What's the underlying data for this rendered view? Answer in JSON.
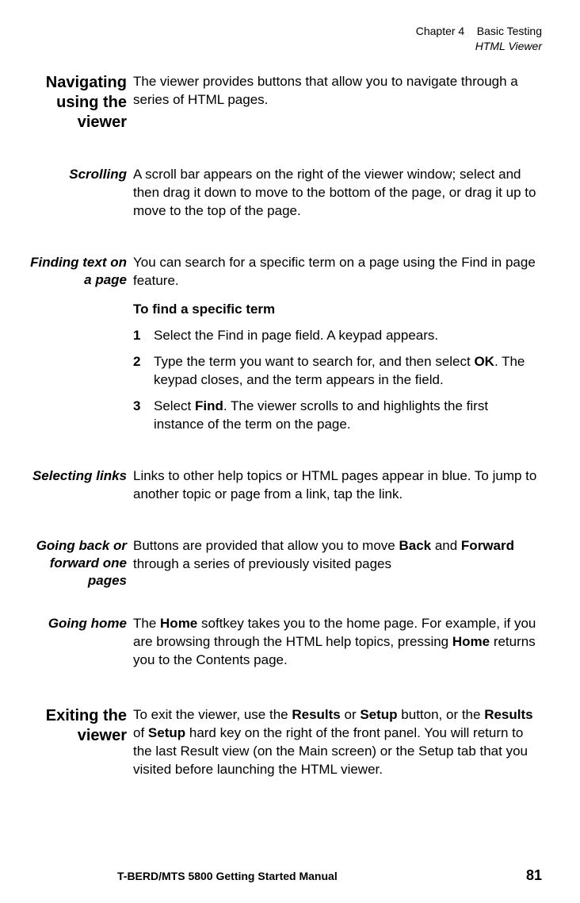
{
  "header": {
    "chapter_prefix": "Chapter 4",
    "chapter_title": "Basic Testing",
    "section": "HTML Viewer"
  },
  "sections": {
    "navigating": {
      "heading": "Navigating using the viewer",
      "body": "The viewer provides buttons that allow you to navigate through a series of HTML pages."
    },
    "scrolling": {
      "heading": "Scrolling",
      "body": "A scroll bar appears on the right of the viewer window; select and then drag it down to move to the bottom of the page, or drag it up to move to the top of the page."
    },
    "finding": {
      "heading": "Finding text on a page",
      "intro": "You can search for a specific term on a page using the Find in page feature.",
      "subhead": "To find a specific term",
      "steps": [
        {
          "n": "1",
          "t": "Select the Find in page field. A keypad appears."
        },
        {
          "n": "2",
          "t_before": "Type the term you want to search for, and then select ",
          "t_bold": "OK",
          "t_after": ". The keypad closes, and the term appears in the field."
        },
        {
          "n": "3",
          "t_before": "Select ",
          "t_bold": "Find",
          "t_after": ". The viewer scrolls to and highlights the first instance of the term on the page."
        }
      ]
    },
    "links": {
      "heading": "Selecting links",
      "body": "Links to other help topics or HTML pages appear in blue. To jump to another topic or page from a link, tap the link."
    },
    "backfwd": {
      "heading": "Going back or forward one pages",
      "before": "Buttons are provided that allow you to move ",
      "b1": "Back",
      "mid": " and ",
      "b2": "Forward",
      "after": " through a series of previously visited pages"
    },
    "home": {
      "heading": "Going home",
      "p1a": "The ",
      "p1b": "Home",
      "p1c": " softkey takes you to the home page. For example, if you are browsing through the HTML help topics, pressing ",
      "p1d": "Home",
      "p1e": " returns you to the Contents page."
    },
    "exiting": {
      "heading": "Exiting the viewer",
      "a": "To exit the viewer, use the ",
      "b1": "Results",
      "c": " or ",
      "b2": "Setup",
      "d": " button, or the ",
      "b3": "Results",
      "e": " of ",
      "b4": "Setup",
      "f": " hard key on the right of the front panel. You will return to the last Result view (on the Main screen) or the Setup tab that you visited before launching the HTML viewer."
    }
  },
  "footer": {
    "manual": "T-BERD/MTS 5800 Getting Started Manual",
    "page": "81"
  }
}
